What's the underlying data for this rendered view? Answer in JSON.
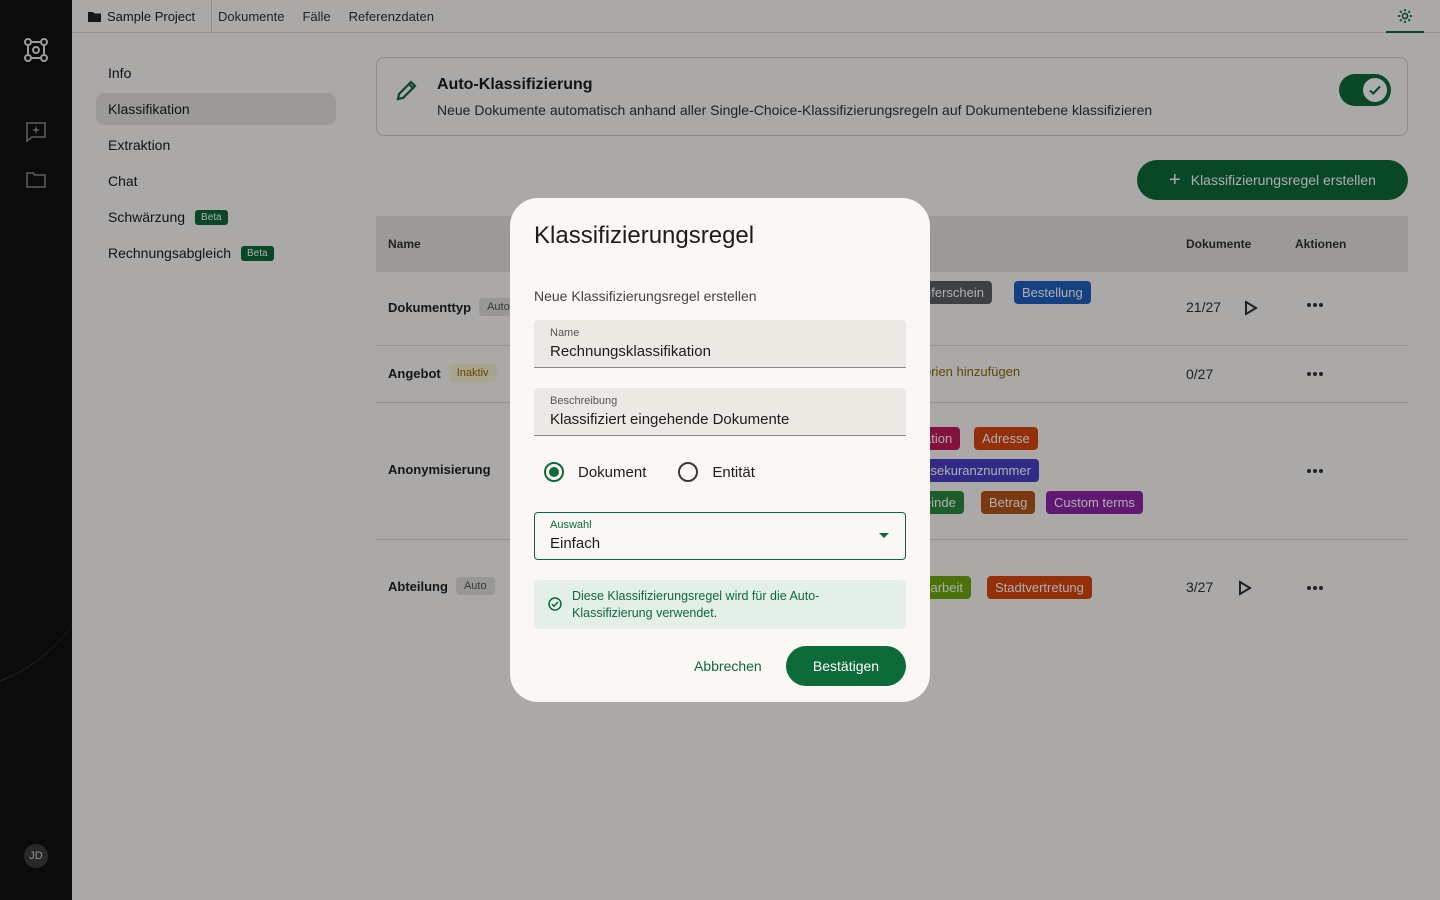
{
  "topbar": {
    "project": "Sample Project",
    "tabs": [
      "Dokumente",
      "Fälle",
      "Referenzdaten"
    ]
  },
  "sidenav": {
    "items": [
      {
        "label": "Info",
        "badge": ""
      },
      {
        "label": "Klassifikation",
        "badge": ""
      },
      {
        "label": "Extraktion",
        "badge": ""
      },
      {
        "label": "Chat",
        "badge": ""
      },
      {
        "label": "Schwärzung",
        "badge": "Beta"
      },
      {
        "label": "Rechnungsabgleich",
        "badge": "Beta"
      }
    ]
  },
  "user": {
    "initials": "JD"
  },
  "banner": {
    "title": "Auto-Klassifizierung",
    "description": "Neue Dokumente automatisch anhand aller Single-Choice-Klassifizierungsregeln auf Dokumentebene klassifizieren"
  },
  "create_button": "Klassifizierungsregel erstellen",
  "table": {
    "headers": {
      "name": "Name",
      "documents": "Dokumente",
      "actions": "Aktionen"
    },
    "rows": [
      {
        "name": "Dokumenttyp",
        "chip": "Auto",
        "tags": [
          "eferschein",
          "Bestellung"
        ],
        "count": "21/27"
      },
      {
        "name": "Angebot",
        "chip": "Inaktiv",
        "hint": "orien hinzufügen",
        "count": "0/27"
      },
      {
        "name": "Anonymisierung",
        "tags": [
          "ation",
          "Adresse",
          "ssekuranznummer",
          "einde",
          "Betrag",
          "Custom terms"
        ]
      },
      {
        "name": "Abteilung",
        "chip": "Auto",
        "tags": [
          "sarbeit",
          "Stadtvertretung"
        ],
        "count": "3/27"
      }
    ]
  },
  "modal": {
    "title": "Klassifizierungsregel",
    "subtitle": "Neue Klassifizierungsregel erstellen",
    "name_label": "Name",
    "name_value": "Rechnungsklassifikation",
    "desc_label": "Beschreibung",
    "desc_value": "Klassifiziert eingehende Dokumente",
    "radio_document": "Dokument",
    "radio_entity": "Entität",
    "select_label": "Auswahl",
    "select_value": "Einfach",
    "info": "Diese Klassifizierungsregel wird für die Auto-Klassifizierung verwendet.",
    "cancel": "Abbrechen",
    "confirm": "Bestätigen"
  },
  "colors": {
    "accent": "#0d6b3a",
    "tag_gray": "#5a5f66",
    "tag_blue": "#1f5fbf",
    "tag_magenta": "#c2185b",
    "tag_orange": "#d9480f",
    "tag_indigo": "#4a3fc8",
    "tag_green": "#2b8a3e",
    "tag_brown": "#b5541a",
    "tag_purple": "#8e24aa",
    "tag_lime": "#6fa80f"
  }
}
